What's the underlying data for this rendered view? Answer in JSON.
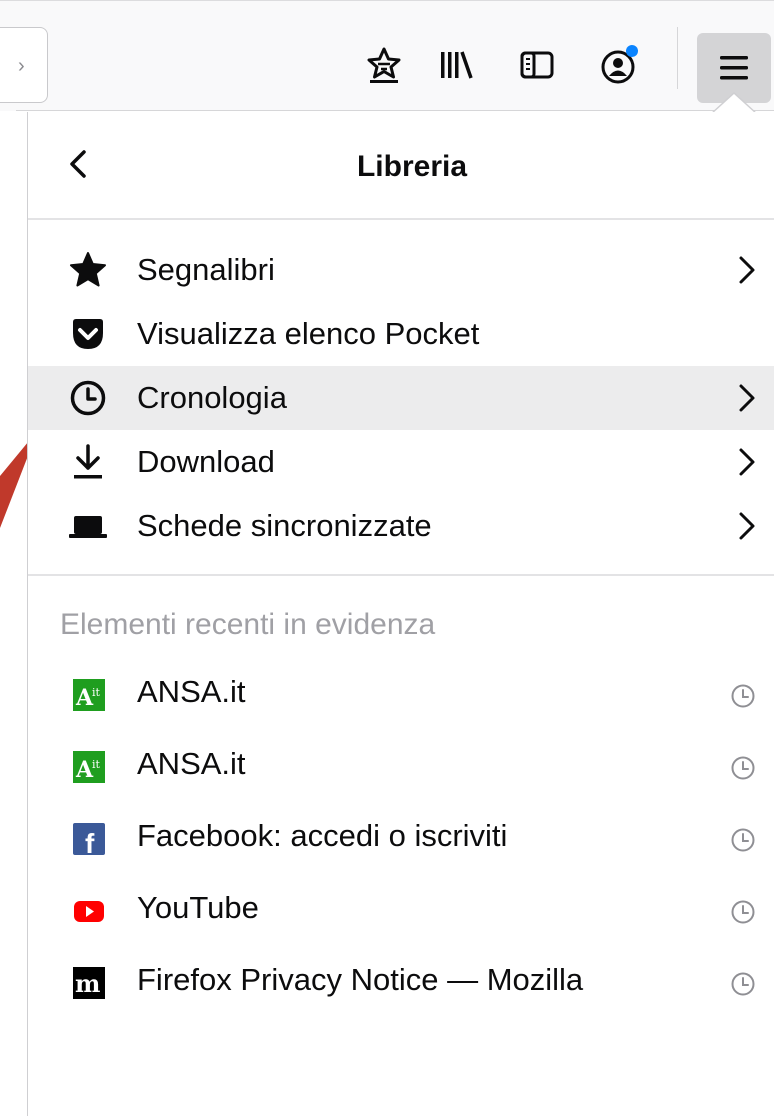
{
  "toolbar": {
    "icons": [
      "bookmark-star-icon",
      "library-icon",
      "sidebar-icon",
      "account-icon",
      "hamburger-menu-icon"
    ],
    "notification_dot_color": "#0a84ff",
    "urlbar_chevron": "›"
  },
  "panel": {
    "title": "Libreria",
    "back_glyph": "<",
    "items": [
      {
        "label": "Segnalibri",
        "icon": "star-icon",
        "has_submenu": true
      },
      {
        "label": "Visualizza elenco Pocket",
        "icon": "pocket-icon",
        "has_submenu": false
      },
      {
        "label": "Cronologia",
        "icon": "clock-icon",
        "has_submenu": true,
        "active": true
      },
      {
        "label": "Download",
        "icon": "download-icon",
        "has_submenu": true
      },
      {
        "label": "Schede sincronizzate",
        "icon": "synced-tabs-icon",
        "has_submenu": true
      }
    ],
    "recent_heading": "Elementi recenti in evidenza",
    "recent": [
      {
        "label": "ANSA.it",
        "favicon": "ansa-favicon",
        "type_icon": "history-clock-icon"
      },
      {
        "label": "ANSA.it",
        "favicon": "ansa-favicon",
        "type_icon": "history-clock-icon"
      },
      {
        "label": "Facebook: accedi o iscriviti",
        "favicon": "facebook-favicon",
        "type_icon": "history-clock-icon"
      },
      {
        "label": "YouTube",
        "favicon": "youtube-favicon",
        "type_icon": "history-clock-icon"
      },
      {
        "label": "Firefox Privacy Notice — Mozilla",
        "favicon": "mozilla-favicon",
        "type_icon": "history-clock-icon"
      }
    ],
    "favicon_texts": {
      "ansa": "A",
      "ansa_sup": "it",
      "facebook": "f",
      "mozilla": "m"
    }
  },
  "colors": {
    "active_row": "#ececed",
    "heading_gray": "#a0a0a5",
    "annotation_arrow": "#c0392b",
    "ansa_green": "#1f9e1f",
    "facebook_blue": "#3b5998",
    "youtube_red": "#ff0000"
  }
}
